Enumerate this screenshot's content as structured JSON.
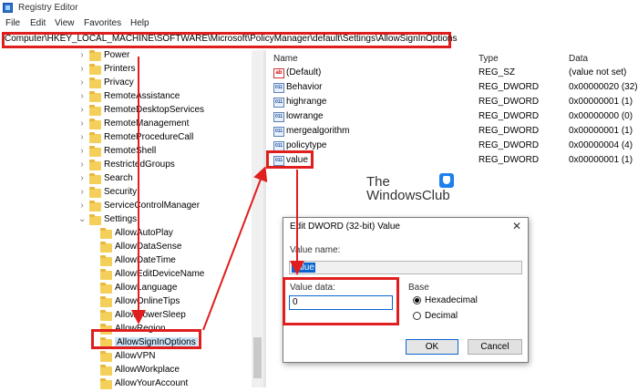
{
  "window": {
    "title": "Registry Editor"
  },
  "menu": [
    "File",
    "Edit",
    "View",
    "Favorites",
    "Help"
  ],
  "address": "Computer\\HKEY_LOCAL_MACHINE\\SOFTWARE\\Microsoft\\PolicyManager\\default\\Settings\\AllowSignInOptions",
  "tree": {
    "items": [
      "Power",
      "Printers",
      "Privacy",
      "RemoteAssistance",
      "RemoteDesktopServices",
      "RemoteManagement",
      "RemoteProcedureCall",
      "RemoteShell",
      "RestrictedGroups",
      "Search",
      "Security",
      "ServiceControlManager",
      "Settings"
    ],
    "settings_children": [
      "AllowAutoPlay",
      "AllowDataSense",
      "AllowDateTime",
      "AllowEditDeviceName",
      "AllowLanguage",
      "AllowOnlineTips",
      "AllowPowerSleep",
      "AllowRegion",
      "AllowSignInOptions",
      "AllowVPN",
      "AllowWorkplace",
      "AllowYourAccount"
    ],
    "selected": "AllowSignInOptions"
  },
  "list": {
    "columns": [
      "Name",
      "Type",
      "Data"
    ],
    "rows": [
      {
        "name": "(Default)",
        "type": "REG_SZ",
        "data": "(value not set)",
        "icon": "string-value-icon"
      },
      {
        "name": "Behavior",
        "type": "REG_DWORD",
        "data": "0x00000020 (32)",
        "icon": "dword-value-icon"
      },
      {
        "name": "highrange",
        "type": "REG_DWORD",
        "data": "0x00000001 (1)",
        "icon": "dword-value-icon"
      },
      {
        "name": "lowrange",
        "type": "REG_DWORD",
        "data": "0x00000000 (0)",
        "icon": "dword-value-icon"
      },
      {
        "name": "mergealgorithm",
        "type": "REG_DWORD",
        "data": "0x00000001 (1)",
        "icon": "dword-value-icon"
      },
      {
        "name": "policytype",
        "type": "REG_DWORD",
        "data": "0x00000004 (4)",
        "icon": "dword-value-icon"
      },
      {
        "name": "value",
        "type": "REG_DWORD",
        "data": "0x00000001 (1)",
        "icon": "dword-value-icon"
      }
    ]
  },
  "watermark": {
    "line1": "The",
    "line2": "WindowsClub"
  },
  "dialog": {
    "title": "Edit DWORD (32-bit) Value",
    "close": "✕",
    "value_name_label": "Value name:",
    "value_name": "value",
    "value_data_label": "Value data:",
    "value_data": "0",
    "base_label": "Base",
    "base_options": [
      "Hexadecimal",
      "Decimal"
    ],
    "base_selected": "Hexadecimal",
    "ok": "OK",
    "cancel": "Cancel"
  },
  "colors": {
    "highlight": "#e01e1e",
    "selection": "#0a64d0",
    "folder": "#f4cf5a"
  }
}
